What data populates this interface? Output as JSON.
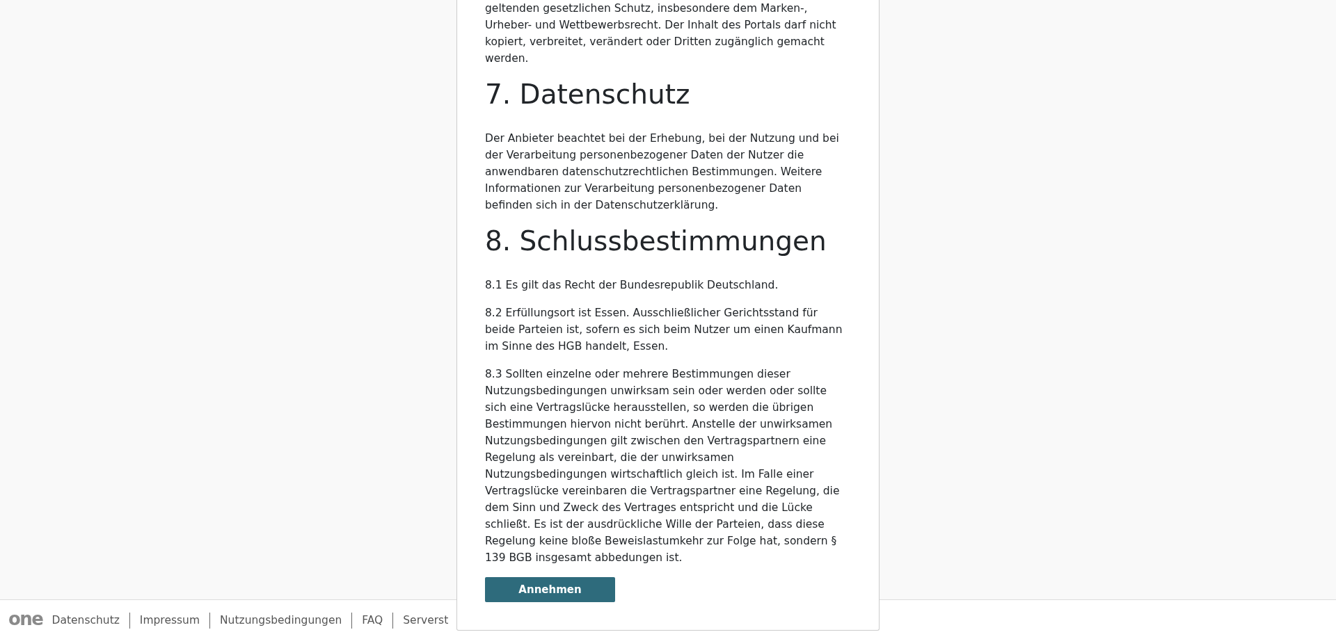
{
  "terms": {
    "sections": [
      {
        "kind": "paragraph",
        "text": "geltenden gesetzlichen Schutz, insbesondere dem Marken-, Urheber- und Wettbewerbsrecht. Der Inhalt des Portals darf nicht kopiert, verbreitet, verändert oder Dritten zugänglich gemacht werden."
      },
      {
        "kind": "heading",
        "text": "7. Datenschutz"
      },
      {
        "kind": "paragraph",
        "text": "Der Anbieter beachtet bei der Erhebung, bei der Nutzung und bei der Verarbeitung personenbezogener Daten der Nutzer die anwendbaren datenschutzrechtlichen Bestimmungen. Weitere Informationen zur Verarbeitung personenbezogener Daten befinden sich in der Datenschutzerklärung."
      },
      {
        "kind": "heading",
        "text": "8. Schlussbestimmungen"
      },
      {
        "kind": "paragraph",
        "text": "8.1 Es gilt das Recht der Bundesrepublik Deutschland."
      },
      {
        "kind": "paragraph",
        "text": "8.2 Erfüllungsort ist Essen. Ausschließlicher Gerichtsstand für beide Parteien ist, sofern es sich beim Nutzer um einen Kaufmann im Sinne des HGB handelt, Essen."
      },
      {
        "kind": "paragraph",
        "text": "8.3 Sollten einzelne oder mehrere Bestimmungen dieser Nutzungsbedingungen unwirksam sein oder werden oder sollte sich eine Vertragslücke herausstellen, so werden die übrigen Bestimmungen hiervon nicht berührt. Anstelle der unwirksamen Nutzungsbedingungen gilt zwischen den Vertragspartnern eine Regelung als vereinbart, die der unwirksamen Nutzungsbedingungen wirtschaftlich gleich ist. Im Falle einer Vertragslücke vereinbaren die Vertragspartner eine Regelung, die dem Sinn und Zweck des Vertrages entspricht und die Lücke schließt. Es ist der ausdrückliche Wille der Parteien, dass diese Regelung keine bloße Beweislastumkehr zur Folge hat, sondern § 139 BGB insgesamt abbedungen ist."
      }
    ]
  },
  "accept_button": {
    "label": "Annehmen"
  },
  "footer": {
    "logo": "one",
    "links": [
      "Datenschutz",
      "Impressum",
      "Nutzungsbedingungen",
      "FAQ",
      "Serverst"
    ]
  }
}
